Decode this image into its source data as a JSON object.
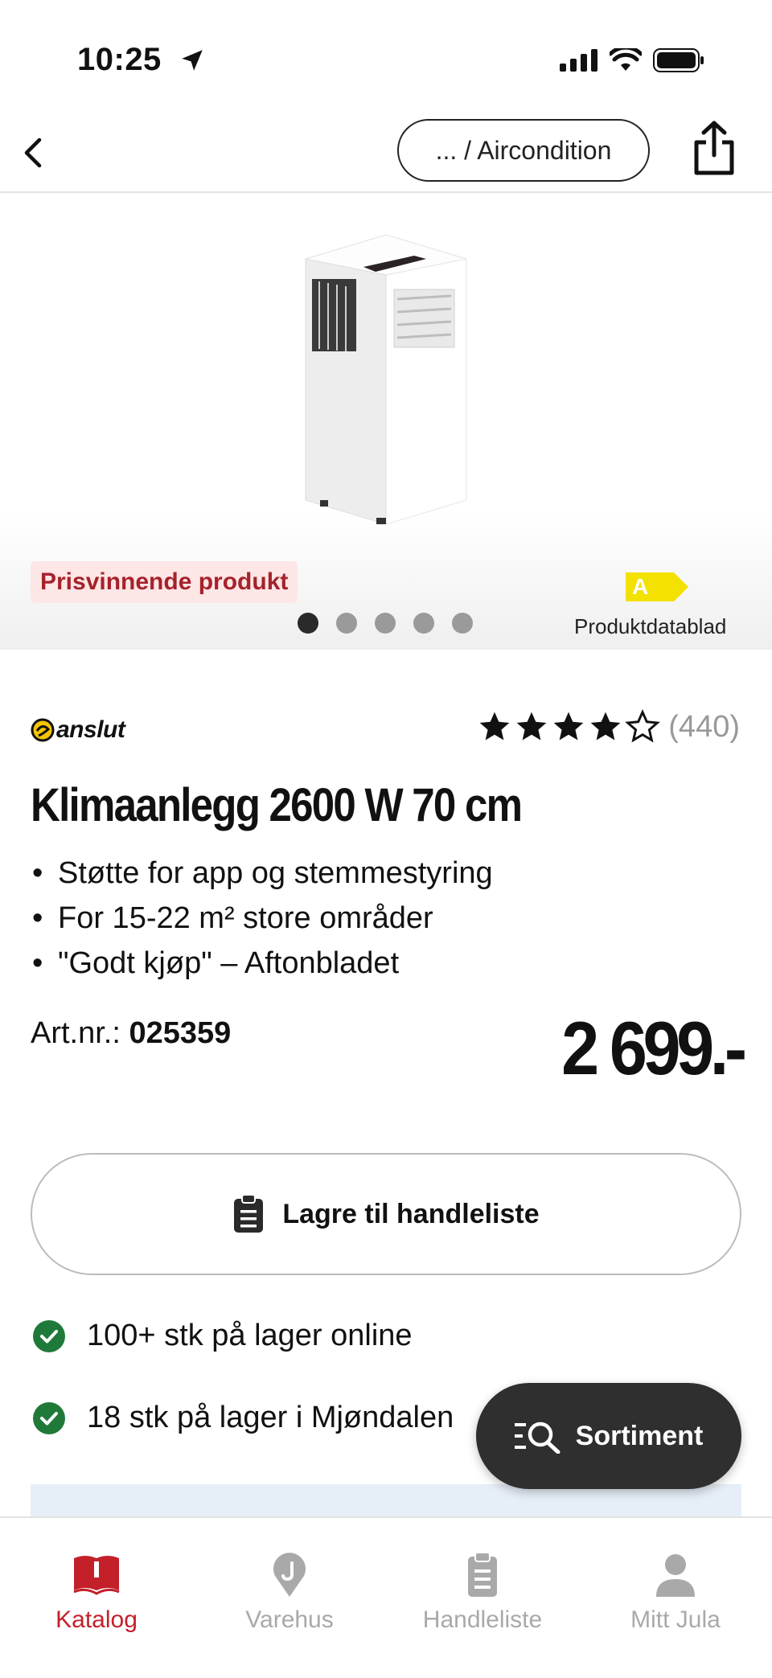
{
  "status_bar": {
    "time": "10:25"
  },
  "nav": {
    "breadcrumb": "... / Aircondition"
  },
  "gallery": {
    "badge": "Prisvinnende produkt",
    "energy_class": "A",
    "datasheet_link": "Produktdatablad",
    "image_count": 5,
    "active_image": 1
  },
  "product": {
    "brand": "anslut",
    "rating": 4.5,
    "rating_count": "(440)",
    "title": "Klimaanlegg 2600 W 70 cm",
    "bullets": [
      "Støtte for app og stemmestyring",
      "For 15-22 m² store områder",
      "\"Godt kjøp\" – Aftonbladet"
    ],
    "artnr_label": "Art.nr.:",
    "artnr_value": "025359",
    "price": "2 699.-"
  },
  "actions": {
    "save_label": "Lagre til handleliste"
  },
  "stock": [
    {
      "text": "100+ stk på lager online"
    },
    {
      "text": "18 stk på lager i Mjøndalen"
    }
  ],
  "fab": {
    "label": "Sortiment"
  },
  "tabs": [
    {
      "label": "Katalog",
      "icon": "book-icon",
      "active": true
    },
    {
      "label": "Varehus",
      "icon": "location-pin-icon",
      "active": false
    },
    {
      "label": "Handleliste",
      "icon": "clipboard-icon",
      "active": false
    },
    {
      "label": "Mitt Jula",
      "icon": "person-icon",
      "active": false
    }
  ],
  "colors": {
    "accent": "#c3202a",
    "success": "#1f7a3a",
    "dark": "#2f2f2f",
    "energy": "#f3e100"
  }
}
